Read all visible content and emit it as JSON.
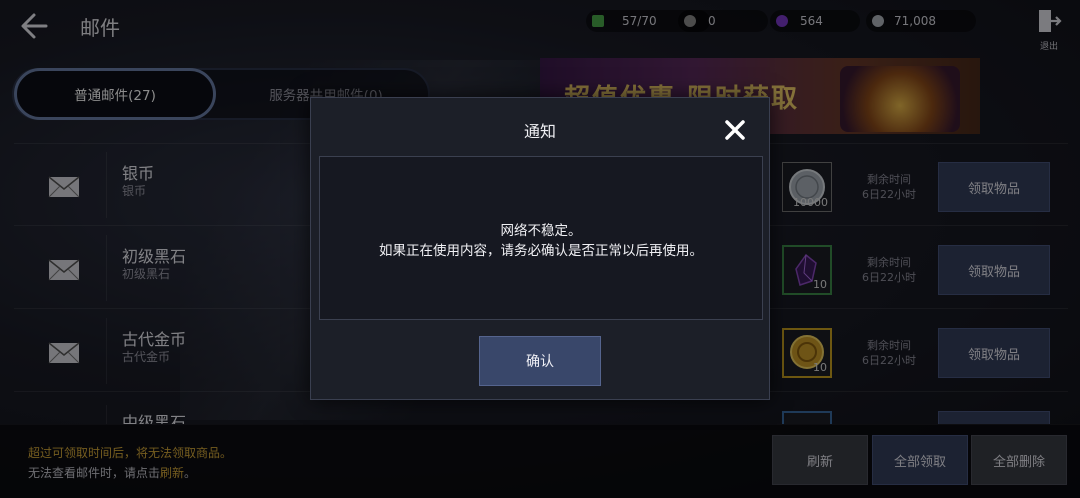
{
  "header": {
    "title": "邮件",
    "exit_label": "退出",
    "currencies": [
      {
        "icon": "stamina-icon",
        "value": "57/70",
        "color": "#4aa84a"
      },
      {
        "icon": "silver-stone-icon",
        "value": "0",
        "color": "#8a8a8a"
      },
      {
        "icon": "black-pearl-icon",
        "value": "564",
        "color": "#7a3ac8"
      },
      {
        "icon": "silver-coin-icon",
        "value": "71,008",
        "color": "#b0b4bc"
      }
    ]
  },
  "tabs": [
    {
      "label": "普通邮件(27)",
      "active": true
    },
    {
      "label": "服务器共用邮件(0)",
      "active": false
    }
  ],
  "banner": {
    "text": "超值优惠 限时获取"
  },
  "mails": [
    {
      "title": "银币",
      "subtitle": "银币",
      "item_icon": "silver-coin-icon",
      "quantity": "10000",
      "remain_label": "剩余时间",
      "remain_value": "6日22小时",
      "claim_label": "领取物品"
    },
    {
      "title": "初级黑石",
      "subtitle": "初级黑石",
      "item_icon": "black-stone-icon",
      "quantity": "10",
      "remain_label": "剩余时间",
      "remain_value": "6日22小时",
      "claim_label": "领取物品"
    },
    {
      "title": "古代金币",
      "subtitle": "古代金币",
      "item_icon": "ancient-gold-coin-icon",
      "quantity": "10",
      "remain_label": "剩余时间",
      "remain_value": "6日22小时",
      "claim_label": "领取物品"
    },
    {
      "title": "中级黑石"
    }
  ],
  "footer": {
    "notice_line1": "超过可领取时间后，将无法领取商品。",
    "notice_line2_prefix": "无法查看邮件时，请点击",
    "notice_line2_link": "刷新",
    "notice_line2_suffix": "。",
    "refresh_label": "刷新",
    "claim_all_label": "全部领取",
    "delete_all_label": "全部删除"
  },
  "dialog": {
    "title": "通知",
    "message_line1": "网络不稳定。",
    "message_line2": "如果正在使用内容，请务必确认是否正常以后再使用。",
    "confirm_label": "确认"
  }
}
